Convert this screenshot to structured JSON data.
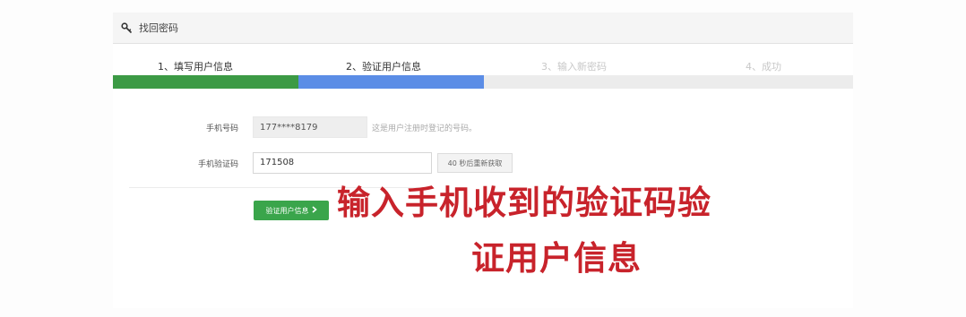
{
  "header": {
    "title": "找回密码",
    "icon": "key-icon"
  },
  "steps": [
    {
      "label": "1、填写用户信息",
      "state": "done"
    },
    {
      "label": "2、验证用户信息",
      "state": "current"
    },
    {
      "label": "3、输入新密码",
      "state": "pending"
    },
    {
      "label": "4、成功",
      "state": "pending"
    }
  ],
  "colors": {
    "step_done": "#3c9a45",
    "step_current": "#5b8de6",
    "step_pending": "#ececec",
    "button_green": "#3aa54b",
    "caption_red": "#c8232b"
  },
  "form": {
    "phone_label": "手机号码",
    "phone_value": "177****8179",
    "phone_hint": "这是用户注册时登记的号码。",
    "code_label": "手机验证码",
    "code_value": "171508",
    "resend_label": "40 秒后重新获取",
    "submit_label": "验证用户信息",
    "submit_icon": "chevron-right-icon"
  },
  "caption": {
    "line1": "输入手机收到的验证码验",
    "line2": "证用户信息"
  }
}
